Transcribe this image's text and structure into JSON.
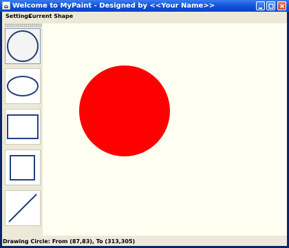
{
  "window": {
    "title": "Welcome to MyPaint - Designed by <<Your Name>>"
  },
  "menubar": {
    "items": [
      {
        "label": "Settings"
      },
      {
        "label": "Current Shape"
      }
    ]
  },
  "toolbar": {
    "tools": [
      {
        "name": "circle",
        "icon": "circle-icon",
        "selected": true
      },
      {
        "name": "oval",
        "icon": "oval-icon",
        "selected": false
      },
      {
        "name": "rectangle",
        "icon": "rectangle-icon",
        "selected": false
      },
      {
        "name": "square",
        "icon": "square-icon",
        "selected": false
      },
      {
        "name": "line",
        "icon": "line-icon",
        "selected": false
      }
    ]
  },
  "canvas": {
    "background": "#fffff2",
    "shapes": [
      {
        "type": "circle",
        "fill": "#ff0000"
      }
    ]
  },
  "statusbar": {
    "text": "Drawing Circle: From (87,83), To (313,305)"
  },
  "colors": {
    "shape_icon_stroke": "#1f3f7a",
    "title_bar": "#0a4bd0"
  }
}
